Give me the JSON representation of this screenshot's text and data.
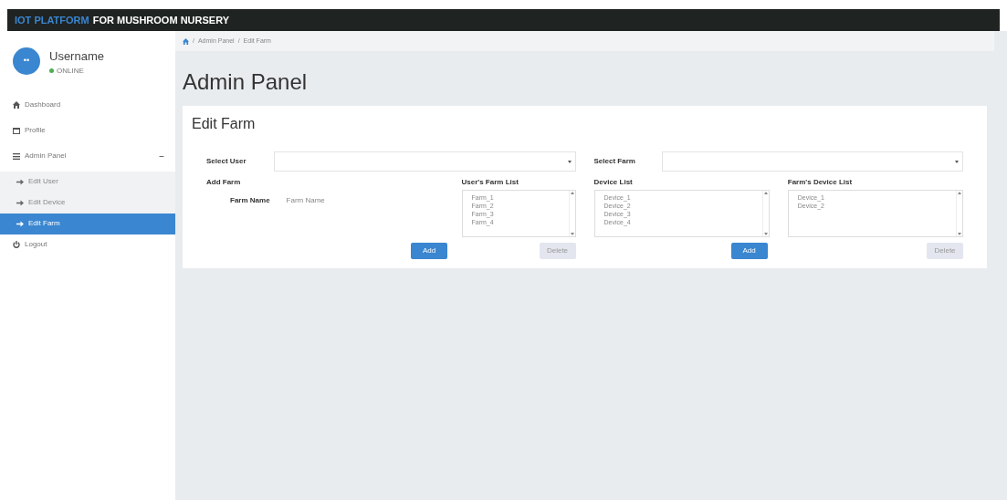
{
  "header": {
    "brand_highlight": "IOT PLATFORM",
    "brand_rest": "FOR MUSHROOM NURSERY"
  },
  "user": {
    "avatar": "••",
    "name": "Username",
    "status": "ONLINE"
  },
  "sidebar": {
    "items": [
      {
        "label": "Dashboard",
        "selected": false
      },
      {
        "label": "Profile",
        "selected": false
      },
      {
        "label": "Admin Panel",
        "selected": false,
        "expanded": true,
        "toggle": "−",
        "children": [
          {
            "label": "Edit User",
            "selected": false
          },
          {
            "label": "Edit Device",
            "selected": false
          },
          {
            "label": "Edit Farm",
            "selected": true
          }
        ]
      },
      {
        "label": "Logout",
        "selected": false
      }
    ]
  },
  "breadcrumb": [
    {
      "separator": "/",
      "label": "Admin Panel"
    },
    {
      "separator": "/",
      "label": "Edit Farm"
    }
  ],
  "page_title": "Admin Panel",
  "card": {
    "title": "Edit Farm",
    "left": {
      "select_label": "Select User",
      "section_label": "Add Farm",
      "field_label": "Farm Name",
      "field_placeholder": "Farm Name",
      "list_title": "User's Farm List",
      "list_items": [
        "Farm_1",
        "Farm_2",
        "Farm_3",
        "Farm_4"
      ],
      "add_button": "Add",
      "delete_button": "Delete"
    },
    "right": {
      "select_label": "Select Farm",
      "list1_title": "Device List",
      "list1_items": [
        "Device_1",
        "Device_2",
        "Device_3",
        "Device_4"
      ],
      "list2_title": "Farm's Device List",
      "list2_items": [
        "Device_1",
        "Device_2"
      ],
      "add_button": "Add",
      "delete_button": "Delete"
    }
  }
}
